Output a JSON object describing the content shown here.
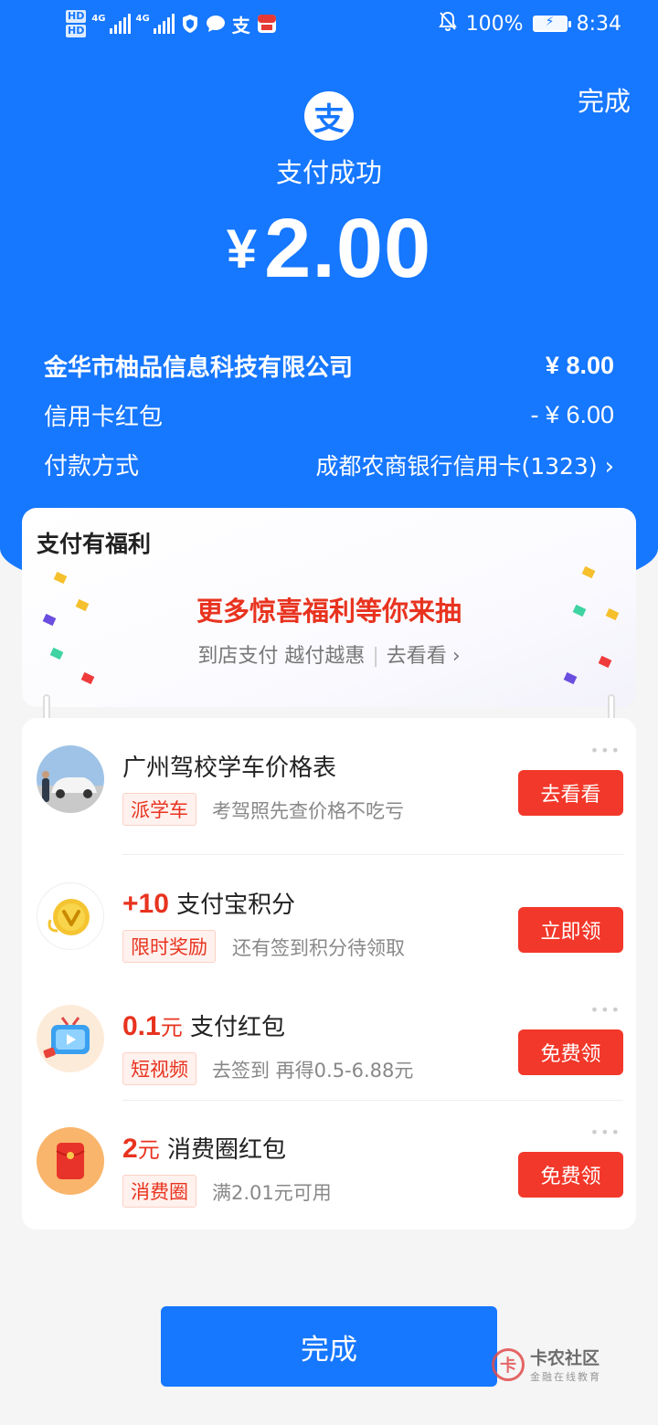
{
  "status_bar": {
    "hd1": "HD",
    "hd2": "HD",
    "net1": "4G",
    "net2": "4G",
    "battery_pct": "100%",
    "time": "8:34",
    "alipay_glyph": "支",
    "icons": [
      "shield-icon",
      "chat-icon",
      "alipay-icon",
      "app-icon",
      "mute-bell-icon",
      "battery-icon"
    ]
  },
  "header": {
    "done_label": "完成",
    "logo_glyph": "支",
    "title": "支付成功",
    "currency": "¥",
    "amount": "2.00"
  },
  "details": [
    {
      "label": "金华市柚品信息科技有限公司",
      "value": "¥ 8.00"
    },
    {
      "label": "信用卡红包",
      "value": "- ¥ 6.00"
    },
    {
      "label": "付款方式",
      "value": "成都农商银行信用卡(1323)",
      "chevron": "›"
    }
  ],
  "benefit": {
    "title": "支付有福利",
    "main": "更多惊喜福利等你来抽",
    "sub_left": "到店支付 越付越惠",
    "sub_link": "去看看",
    "chevron": "›"
  },
  "offers": [
    {
      "title": "广州驾校学车价格表",
      "tag": "派学车",
      "desc": "考驾照先查价格不吃亏",
      "button": "去看看",
      "icon": "driving-school-avatar"
    },
    {
      "highlight": "+10",
      "title": "支付宝积分",
      "tag": "限时奖励",
      "desc": "还有签到积分待领取",
      "button": "立即领",
      "icon": "points-coin-icon"
    },
    {
      "highlight": "0.1",
      "highlight_unit": "元",
      "title": "支付红包",
      "tag": "短视频",
      "desc": "去签到 再得0.5-6.88元",
      "button": "免费领",
      "icon": "tv-icon"
    },
    {
      "highlight": "2",
      "highlight_unit": "元",
      "title": "消费圈红包",
      "tag": "消费圈",
      "desc": "满2.01元可用",
      "button": "免费领",
      "icon": "red-envelope-icon"
    }
  ],
  "footer": {
    "done_label": "完成",
    "watermark_main": "卡农社区",
    "watermark_sub": "金融在线教育",
    "watermark_glyph": "卡"
  },
  "colors": {
    "brand_blue": "#1677ff",
    "accent_red": "#e8331f",
    "button_red": "#f2382a"
  }
}
